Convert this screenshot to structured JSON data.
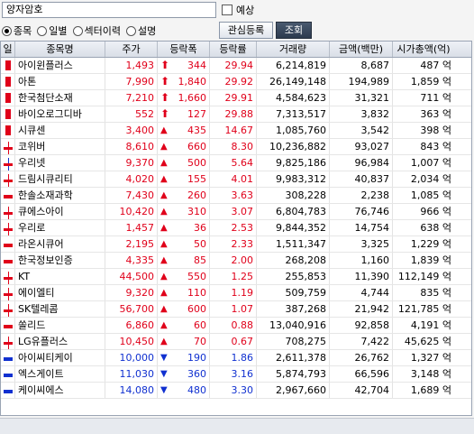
{
  "search": {
    "value": "양자암호"
  },
  "forecast_checkbox": {
    "label": "예상"
  },
  "radios": [
    {
      "label": "종목",
      "selected": true
    },
    {
      "label": "일별",
      "selected": false
    },
    {
      "label": "섹터이력",
      "selected": false
    },
    {
      "label": "설명",
      "selected": false
    }
  ],
  "buttons": {
    "favorite": "관심등록",
    "query": "조회"
  },
  "columns": [
    "일",
    "종목명",
    "주가",
    "등락폭",
    "등락률",
    "거래량",
    "금액(백만)",
    "시가총액(억)"
  ],
  "colors": {
    "up": "#e0001a",
    "down": "#1030d0",
    "header_bg": "#dfe4ec"
  },
  "rows": [
    {
      "name": "아이윈플러스",
      "price": "1,493",
      "change_icon": "limit-up-arrow",
      "change": "344",
      "rate": "29.94",
      "volume": "6,214,819",
      "amount": "8,687",
      "mcap": "487 억",
      "dir": "up",
      "candle": "box"
    },
    {
      "name": "아톤",
      "price": "7,990",
      "change_icon": "limit-up-arrow",
      "change": "1,840",
      "rate": "29.92",
      "volume": "26,149,148",
      "amount": "194,989",
      "mcap": "1,859 억",
      "dir": "up",
      "candle": "box"
    },
    {
      "name": "한국첨단소재",
      "price": "7,210",
      "change_icon": "limit-up-arrow",
      "change": "1,660",
      "rate": "29.91",
      "volume": "4,584,623",
      "amount": "31,321",
      "mcap": "711 억",
      "dir": "up",
      "candle": "box"
    },
    {
      "name": "바이오로그디바",
      "price": "552",
      "change_icon": "limit-up-arrow",
      "change": "127",
      "rate": "29.88",
      "volume": "7,313,517",
      "amount": "3,832",
      "mcap": "363 억",
      "dir": "up",
      "candle": "box"
    },
    {
      "name": "시큐센",
      "price": "3,400",
      "change_icon": "up-triangle",
      "change": "435",
      "rate": "14.67",
      "volume": "1,085,760",
      "amount": "3,542",
      "mcap": "398 억",
      "dir": "up",
      "candle": "box"
    },
    {
      "name": "코위버",
      "price": "8,610",
      "change_icon": "up-triangle",
      "change": "660",
      "rate": "8.30",
      "volume": "10,236,882",
      "amount": "93,027",
      "mcap": "843 억",
      "dir": "up",
      "candle": "wick-up"
    },
    {
      "name": "우리넷",
      "price": "9,370",
      "change_icon": "up-triangle",
      "change": "500",
      "rate": "5.64",
      "volume": "9,825,186",
      "amount": "96,984",
      "mcap": "1,007 억",
      "dir": "up",
      "candle": "wick-down"
    },
    {
      "name": "드림시큐리티",
      "price": "4,020",
      "change_icon": "up-triangle",
      "change": "155",
      "rate": "4.01",
      "volume": "9,983,312",
      "amount": "40,837",
      "mcap": "2,034 억",
      "dir": "up",
      "candle": "wick-up"
    },
    {
      "name": "한솔소재과학",
      "price": "7,430",
      "change_icon": "up-triangle",
      "change": "260",
      "rate": "3.63",
      "volume": "308,228",
      "amount": "2,238",
      "mcap": "1,085 억",
      "dir": "up",
      "candle": "flat-up"
    },
    {
      "name": "큐에스아이",
      "price": "10,420",
      "change_icon": "up-triangle",
      "change": "310",
      "rate": "3.07",
      "volume": "6,804,783",
      "amount": "76,746",
      "mcap": "966 억",
      "dir": "up",
      "candle": "wick-up"
    },
    {
      "name": "우리로",
      "price": "1,457",
      "change_icon": "up-triangle",
      "change": "36",
      "rate": "2.53",
      "volume": "9,844,352",
      "amount": "14,754",
      "mcap": "638 억",
      "dir": "up",
      "candle": "wick-up"
    },
    {
      "name": "라온시큐어",
      "price": "2,195",
      "change_icon": "up-triangle",
      "change": "50",
      "rate": "2.33",
      "volume": "1,511,347",
      "amount": "3,325",
      "mcap": "1,229 억",
      "dir": "up",
      "candle": "flat-up"
    },
    {
      "name": "한국정보인증",
      "price": "4,335",
      "change_icon": "up-triangle",
      "change": "85",
      "rate": "2.00",
      "volume": "268,208",
      "amount": "1,160",
      "mcap": "1,839 억",
      "dir": "up",
      "candle": "flat-up"
    },
    {
      "name": "KT",
      "price": "44,500",
      "change_icon": "up-triangle",
      "change": "550",
      "rate": "1.25",
      "volume": "255,853",
      "amount": "11,390",
      "mcap": "112,149 억",
      "dir": "up",
      "candle": "wick-up"
    },
    {
      "name": "에이엘티",
      "price": "9,320",
      "change_icon": "up-triangle",
      "change": "110",
      "rate": "1.19",
      "volume": "509,759",
      "amount": "4,744",
      "mcap": "835 억",
      "dir": "up",
      "candle": "wick-up"
    },
    {
      "name": "SK텔레콤",
      "price": "56,700",
      "change_icon": "up-triangle",
      "change": "600",
      "rate": "1.07",
      "volume": "387,268",
      "amount": "21,942",
      "mcap": "121,785 억",
      "dir": "up",
      "candle": "wick-up"
    },
    {
      "name": "쏠리드",
      "price": "6,860",
      "change_icon": "up-triangle",
      "change": "60",
      "rate": "0.88",
      "volume": "13,040,916",
      "amount": "92,858",
      "mcap": "4,191 억",
      "dir": "up",
      "candle": "flat-up"
    },
    {
      "name": "LG유플러스",
      "price": "10,450",
      "change_icon": "up-triangle",
      "change": "70",
      "rate": "0.67",
      "volume": "708,275",
      "amount": "7,422",
      "mcap": "45,625 억",
      "dir": "up",
      "candle": "wick-up"
    },
    {
      "name": "아이씨티케이",
      "price": "10,000",
      "change_icon": "down-triangle",
      "change": "190",
      "rate": "1.86",
      "volume": "2,611,378",
      "amount": "26,762",
      "mcap": "1,327 억",
      "dir": "down",
      "candle": "flat-down"
    },
    {
      "name": "엑스게이트",
      "price": "11,030",
      "change_icon": "down-triangle",
      "change": "360",
      "rate": "3.16",
      "volume": "5,874,793",
      "amount": "66,596",
      "mcap": "3,148 억",
      "dir": "down",
      "candle": "flat-down"
    },
    {
      "name": "케이씨에스",
      "price": "14,080",
      "change_icon": "down-triangle",
      "change": "480",
      "rate": "3.30",
      "volume": "2,967,660",
      "amount": "42,704",
      "mcap": "1,689 억",
      "dir": "down",
      "candle": "flat-down"
    }
  ]
}
